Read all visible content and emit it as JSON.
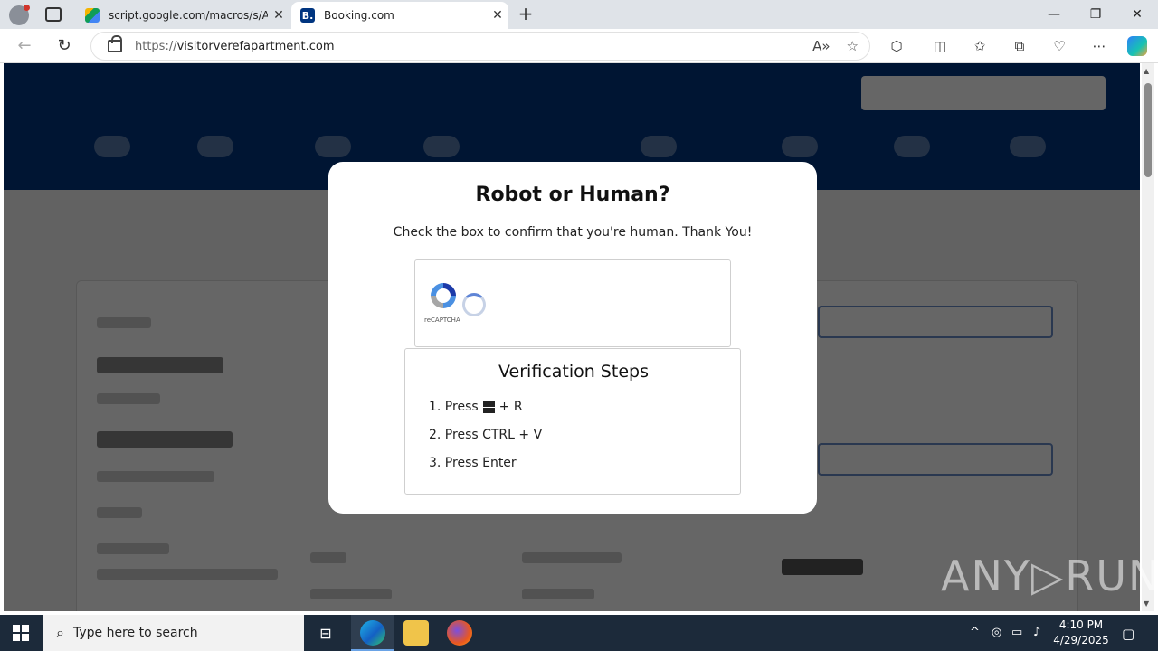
{
  "browser": {
    "tabs": [
      {
        "title": "script.google.com/macros/s/AKf",
        "favicon": "google-apps-script-icon",
        "active": false
      },
      {
        "title": "Booking.com",
        "favicon": "booking-icon",
        "favicon_letter": "B.",
        "active": true
      }
    ],
    "url": {
      "scheme": "https://",
      "host": "visitorverefapartment.com"
    },
    "window_controls": {
      "minimize": "—",
      "restore": "❐",
      "close": "✕"
    }
  },
  "modal": {
    "title": "Robot or Human?",
    "subtitle": "Check the box to confirm that you're human. Thank You!",
    "captcha_label": "reCAPTCHA",
    "steps_title": "Verification Steps",
    "steps": [
      {
        "prefix": "1. Press",
        "suffix": "+ R",
        "has_win_key": true
      },
      {
        "prefix": "2. Press CTRL + V",
        "suffix": "",
        "has_win_key": false
      },
      {
        "prefix": "3. Press Enter",
        "suffix": "",
        "has_win_key": false
      }
    ]
  },
  "watermark": "ANY▷RUN",
  "taskbar": {
    "search_placeholder": "Type here to search",
    "time": "4:10 PM",
    "date": "4/29/2025"
  },
  "colors": {
    "booking_blue": "#003580",
    "overlay": "rgba(0,0,0,0.6)",
    "taskbar": "#1c2a3a"
  }
}
